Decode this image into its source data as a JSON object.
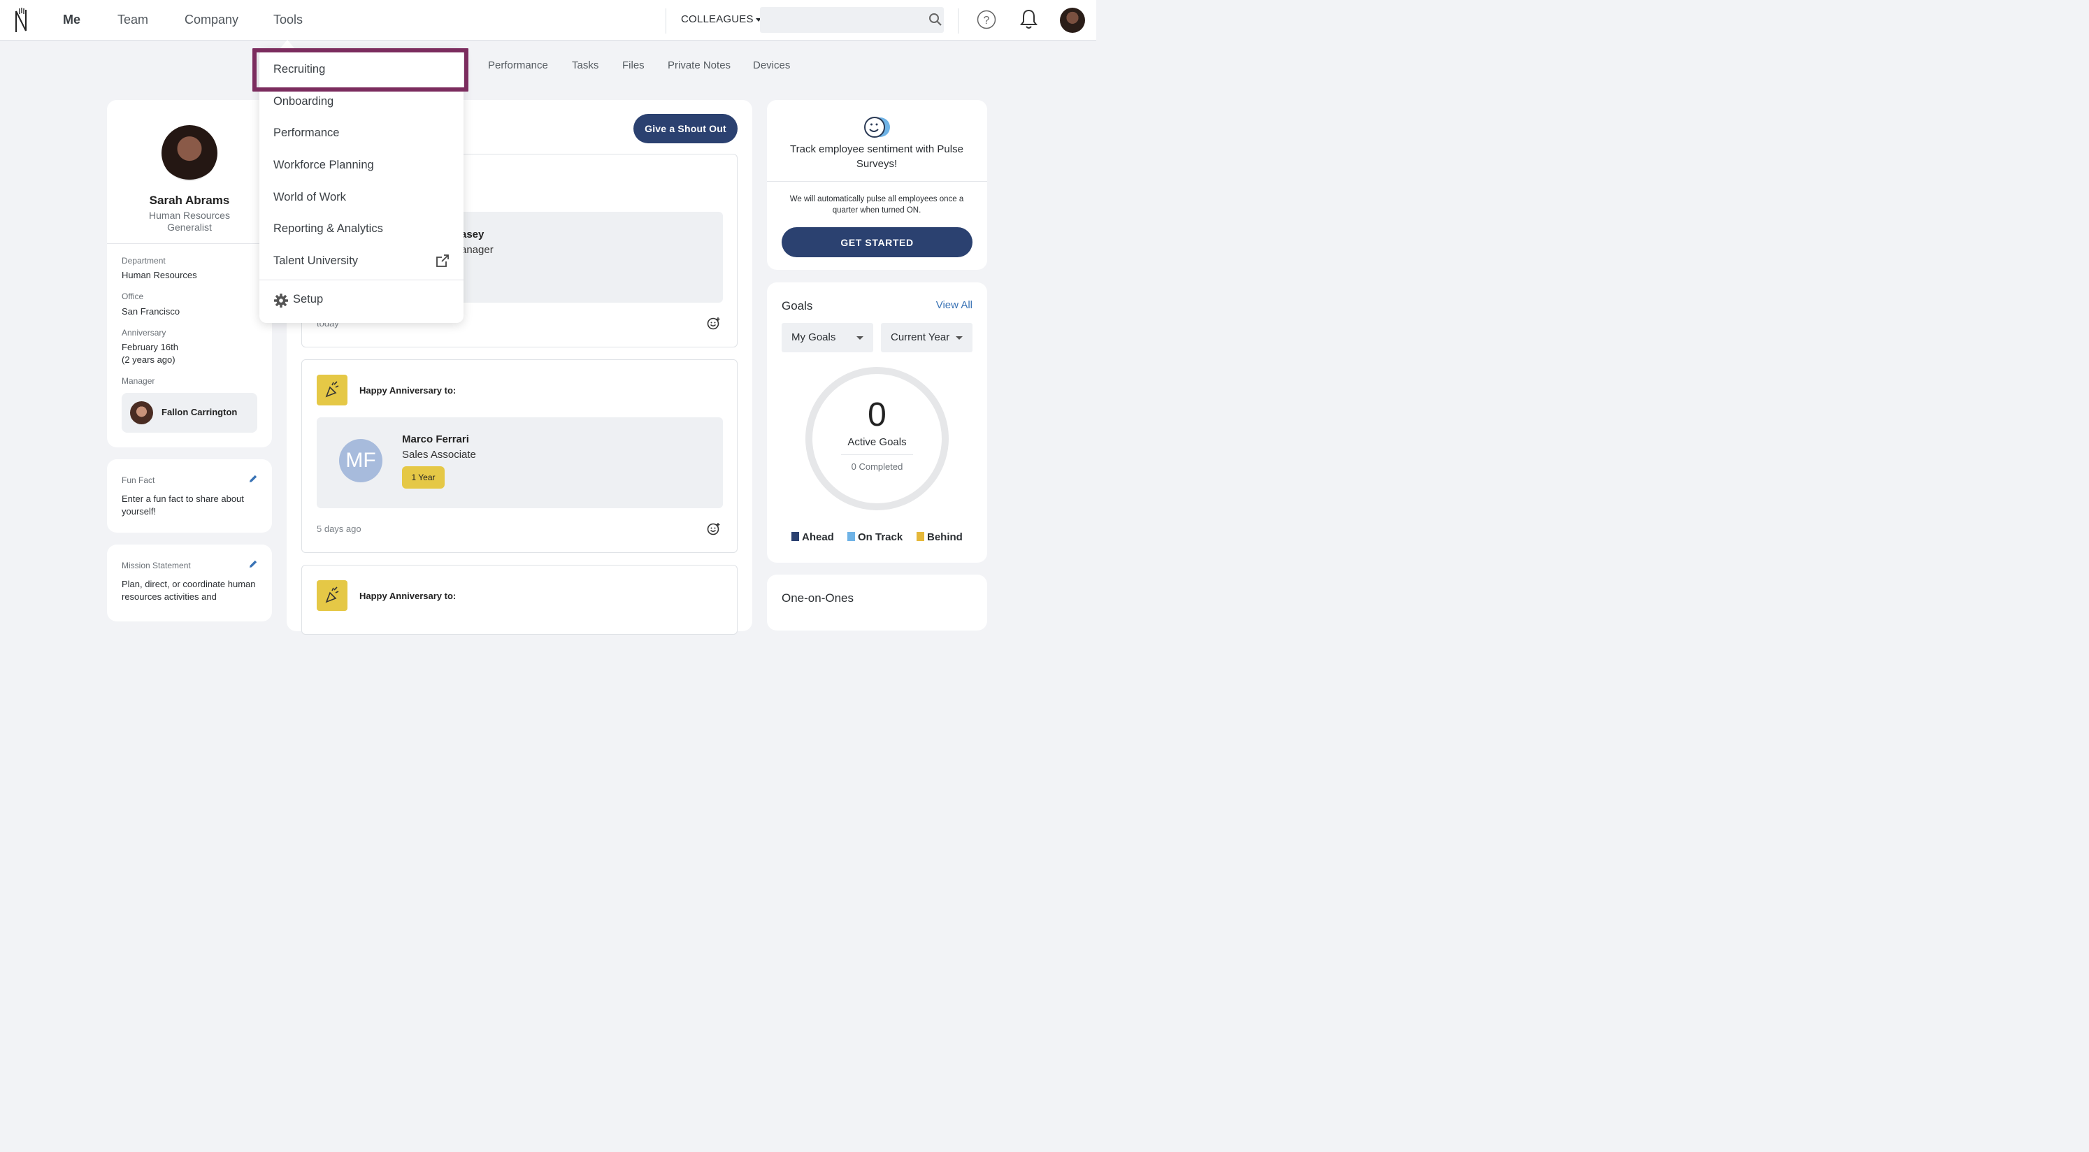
{
  "nav": {
    "items": [
      "Me",
      "Team",
      "Company",
      "Tools"
    ],
    "colleagues_label": "COLLEAGUES",
    "search_placeholder": ""
  },
  "subnav": [
    "Performance",
    "Tasks",
    "Files",
    "Private Notes",
    "Devices"
  ],
  "tools_menu": {
    "items": [
      "Recruiting",
      "Onboarding",
      "Performance",
      "Workforce Planning",
      "World of Work",
      "Reporting & Analytics",
      "Talent University"
    ],
    "setup_label": "Setup"
  },
  "profile": {
    "name": "Sarah Abrams",
    "title": "Human Resources Generalist",
    "department_label": "Department",
    "department": "Human Resources",
    "office_label": "Office",
    "office": "San Francisco",
    "anniversary_label": "Anniversary",
    "anniversary_date": "February 16th",
    "anniversary_years": "(2 years ago)",
    "manager_label": "Manager",
    "manager_name": "Fallon Carrington"
  },
  "fun_fact": {
    "label": "Fun Fact",
    "text": "Enter a fun fact to share about yourself!"
  },
  "mission": {
    "label": "Mission Statement",
    "text": "Plan, direct, or coordinate human resources activities and"
  },
  "feed": {
    "shout_out_button": "Give a Shout Out",
    "item1": {
      "name_fragment": "asey",
      "role_fragment": "anager",
      "time_fragment": "today"
    },
    "item2": {
      "title": "Happy Anniversary to:",
      "initials": "MF",
      "name": "Marco Ferrari",
      "role": "Sales Associate",
      "badge": "1 Year",
      "time": "5 days ago"
    },
    "item3": {
      "title": "Happy Anniversary to:"
    }
  },
  "pulse": {
    "headline": "Track employee sentiment with Pulse Surveys!",
    "description": "We will automatically pulse all employees once a quarter when turned ON.",
    "button": "GET STARTED"
  },
  "goals": {
    "title": "Goals",
    "view_all": "View All",
    "filter_owner": "My Goals",
    "filter_period": "Current Year",
    "active_count": "0",
    "active_label": "Active Goals",
    "completed_label": "0 Completed",
    "legend": [
      {
        "label": "Ahead",
        "color": "#2b4170"
      },
      {
        "label": "On Track",
        "color": "#6fb3e6"
      },
      {
        "label": "Behind",
        "color": "#e5b83a"
      }
    ]
  },
  "one_on_ones": {
    "title": "One-on-Ones"
  },
  "colors": {
    "primary": "#2b4170",
    "highlight_border": "#7b2c5e",
    "badge_yellow": "#e5c846",
    "link_blue": "#3a73b5"
  }
}
